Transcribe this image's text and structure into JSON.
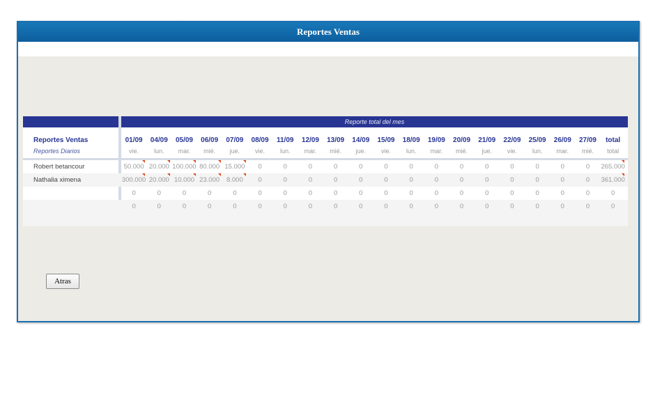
{
  "window": {
    "title": "Reportes Ventas"
  },
  "report": {
    "banner": "Reporte total del mes",
    "header_title": "Reportes Ventas",
    "header_subtitle": "Reportes Diarios",
    "columns": [
      {
        "date": "01/09",
        "day": "vie."
      },
      {
        "date": "04/09",
        "day": "lun."
      },
      {
        "date": "05/09",
        "day": "mar."
      },
      {
        "date": "06/09",
        "day": "mié."
      },
      {
        "date": "07/09",
        "day": "jue."
      },
      {
        "date": "08/09",
        "day": "vie."
      },
      {
        "date": "11/09",
        "day": "lun."
      },
      {
        "date": "12/09",
        "day": "mar."
      },
      {
        "date": "13/09",
        "day": "mié."
      },
      {
        "date": "14/09",
        "day": "jue."
      },
      {
        "date": "15/09",
        "day": "vie."
      },
      {
        "date": "18/09",
        "day": "lun."
      },
      {
        "date": "19/09",
        "day": "mar."
      },
      {
        "date": "20/09",
        "day": "mié."
      },
      {
        "date": "21/09",
        "day": "jue."
      },
      {
        "date": "22/09",
        "day": "vie."
      },
      {
        "date": "25/09",
        "day": "lun."
      },
      {
        "date": "26/09",
        "day": "mar."
      },
      {
        "date": "27/09",
        "day": "mié."
      },
      {
        "date": "total",
        "day": "total"
      }
    ],
    "rows": [
      {
        "name": "Robert betancour",
        "values": [
          "50.000",
          "20.000",
          "100.000",
          "80.000",
          "15.000",
          "0",
          "0",
          "0",
          "0",
          "0",
          "0",
          "0",
          "0",
          "0",
          "0",
          "0",
          "0",
          "0",
          "0",
          "265.000"
        ],
        "flags": [
          1,
          1,
          1,
          1,
          1,
          0,
          0,
          0,
          0,
          0,
          0,
          0,
          0,
          0,
          0,
          0,
          0,
          0,
          0,
          1
        ]
      },
      {
        "name": "Nathalia ximena",
        "values": [
          "300.000",
          "20.000",
          "10.000",
          "23.000",
          "8.000",
          "0",
          "0",
          "0",
          "0",
          "0",
          "0",
          "0",
          "0",
          "0",
          "0",
          "0",
          "0",
          "0",
          "0",
          "361.000"
        ],
        "flags": [
          1,
          1,
          1,
          1,
          1,
          0,
          0,
          0,
          0,
          0,
          0,
          0,
          0,
          0,
          0,
          0,
          0,
          0,
          0,
          1
        ]
      },
      {
        "name": "",
        "values": [
          "0",
          "0",
          "0",
          "0",
          "0",
          "0",
          "0",
          "0",
          "0",
          "0",
          "0",
          "0",
          "0",
          "0",
          "0",
          "0",
          "0",
          "0",
          "0",
          "0"
        ],
        "flags": [
          0,
          0,
          0,
          0,
          0,
          0,
          0,
          0,
          0,
          0,
          0,
          0,
          0,
          0,
          0,
          0,
          0,
          0,
          0,
          0
        ]
      },
      {
        "name": "",
        "values": [
          "0",
          "0",
          "0",
          "0",
          "0",
          "0",
          "0",
          "0",
          "0",
          "0",
          "0",
          "0",
          "0",
          "0",
          "0",
          "0",
          "0",
          "0",
          "0",
          "0"
        ],
        "flags": [
          0,
          0,
          0,
          0,
          0,
          0,
          0,
          0,
          0,
          0,
          0,
          0,
          0,
          0,
          0,
          0,
          0,
          0,
          0,
          0
        ]
      }
    ]
  },
  "buttons": {
    "back_label": "Atras"
  },
  "colors": {
    "title_bar": "#0d5e9e",
    "header_band": "#283593",
    "note_marker": "#e0491a",
    "background": "#ecebe5"
  }
}
